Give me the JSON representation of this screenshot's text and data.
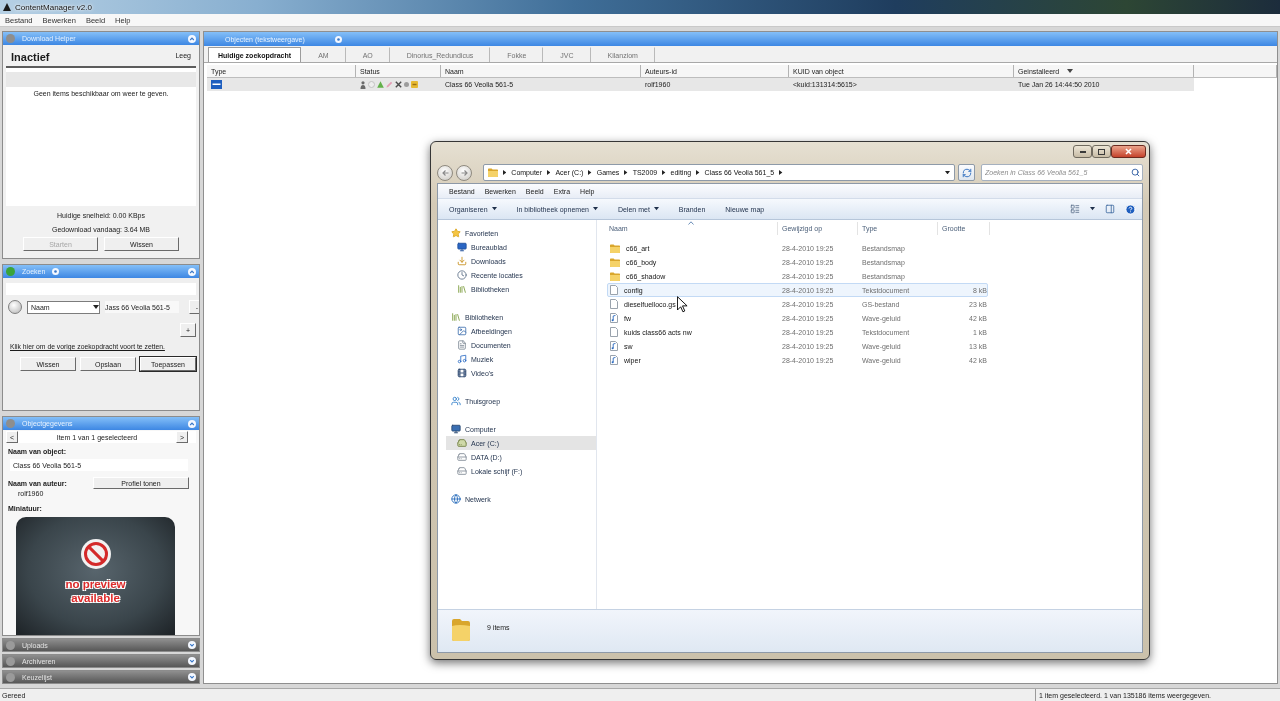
{
  "window": {
    "title": "ContentManager v2.0"
  },
  "menu": [
    "Bestand",
    "Bewerken",
    "Beeld",
    "Help"
  ],
  "left_panels": [
    {
      "kind": "download_helper",
      "title": "Download Helper",
      "expanded": true,
      "color": "#8e8e8e",
      "state": "Inactief",
      "queue": "Leeg",
      "empty_message": "Geen items beschikbaar om weer te geven.",
      "speed": "Huidige snelheid: 0.00 KBps",
      "downloaded_today": "Gedownload vandaag: 3.64 MB",
      "buttons": [
        {
          "label": "Starten",
          "disabled": true
        },
        {
          "label": "Wissen",
          "disabled": false
        }
      ]
    },
    {
      "kind": "search",
      "title": "Zoeken",
      "expanded": true,
      "color": "#3aa43a",
      "field": "Naam",
      "value": "Jass 66 Veolia 561-5",
      "remove_button": "-",
      "add_button": "+",
      "link": "Klik hier om de vorige zoekopdracht voort te zetten.",
      "buttons": [
        {
          "label": "Wissen",
          "default": false
        },
        {
          "label": "Opslaan",
          "default": false
        },
        {
          "label": "Toepassen",
          "default": true
        }
      ]
    },
    {
      "kind": "object_details",
      "title": "Objectgegevens",
      "expanded": true,
      "color": "#8e8e8e",
      "previous": "<",
      "next": ">",
      "selection": "Item 1 van 1 geselecteerd",
      "name_label": "Naam van object:",
      "name": "Class 66 Veolia 561-5",
      "author_label": "Naam van auteur:",
      "profile_button": "Profiel tonen",
      "author": "rolf1960",
      "thumbnail_label": "Miniatuur:",
      "thumbnail_text": "no preview available"
    },
    {
      "kind": "uploads",
      "title": "Uploads",
      "expanded": false,
      "color": "#9a9a9a"
    },
    {
      "kind": "archive",
      "title": "Archiveren",
      "expanded": false,
      "color": "#9a9a9a"
    },
    {
      "kind": "pick_list",
      "title": "Keuzelijst",
      "expanded": false,
      "color": "#9a9a9a"
    }
  ],
  "objects": {
    "title": "Objecten (tekstweergave)",
    "tabs": [
      {
        "label": "Huidige zoekopdracht",
        "selected": true
      },
      {
        "label": "AM",
        "selected": false
      },
      {
        "label": "AO",
        "selected": false
      },
      {
        "label": "Dinorius_Redundicus",
        "selected": false
      },
      {
        "label": "Fokke",
        "selected": false
      },
      {
        "label": "JVC",
        "selected": false
      },
      {
        "label": "Kilanziom",
        "selected": false
      }
    ],
    "columns": [
      {
        "label": "Type",
        "sorted": false
      },
      {
        "label": "Status",
        "sorted": false
      },
      {
        "label": "Naam",
        "sorted": false
      },
      {
        "label": "Auteurs-id",
        "sorted": false
      },
      {
        "label": "KUID van object",
        "sorted": false
      },
      {
        "label": "Geinstalleerd",
        "sorted": true
      }
    ],
    "rows": [
      {
        "name": "Class 66 Veolia 561-5",
        "author_id": "rolf1960",
        "kuid": "<kuid:131314:5615>",
        "installed": "Tue Jan 26 14:44:50 2010",
        "selected": true
      }
    ]
  },
  "explorer": {
    "breadcrumb": [
      "Computer",
      "Acer (C:)",
      "Games",
      "TS2009",
      "editing",
      "Class 66 Veolia 561_5"
    ],
    "search": {
      "placeholder": "Zoeken in Class 66 Veolia 561_5"
    },
    "menu": [
      "Bestand",
      "Bewerken",
      "Beeld",
      "Extra",
      "Help"
    ],
    "toolbar": [
      {
        "label": "Organiseren",
        "dropdown": true
      },
      {
        "label": "In bibliotheek opnemen",
        "dropdown": true
      },
      {
        "label": "Delen met",
        "dropdown": true
      },
      {
        "label": "Branden",
        "dropdown": false
      },
      {
        "label": "Nieuwe map",
        "dropdown": false
      }
    ],
    "navigation": [
      {
        "label": "Favorieten",
        "kind": "star",
        "selected": false,
        "children": [
          {
            "label": "Bureaublad",
            "kind": "desktop",
            "selected": false
          },
          {
            "label": "Downloads",
            "kind": "downloads",
            "selected": false
          },
          {
            "label": "Recente locaties",
            "kind": "recent",
            "selected": false
          },
          {
            "label": "Bibliotheken",
            "kind": "library",
            "selected": false
          }
        ]
      },
      {
        "label": "Bibliotheken",
        "kind": "library",
        "selected": false,
        "children": [
          {
            "label": "Afbeeldingen",
            "kind": "pictures",
            "selected": false
          },
          {
            "label": "Documenten",
            "kind": "documents",
            "selected": false
          },
          {
            "label": "Muziek",
            "kind": "music",
            "selected": false
          },
          {
            "label": "Video's",
            "kind": "videos",
            "selected": false
          }
        ]
      },
      {
        "label": "Thuisgroep",
        "kind": "homegroup",
        "selected": false
      },
      {
        "label": "Computer",
        "kind": "computer",
        "selected": false,
        "children": [
          {
            "label": "Acer (C:)",
            "kind": "system_drive",
            "selected": true
          },
          {
            "label": "DATA (D:)",
            "kind": "drive",
            "selected": false
          },
          {
            "label": "Lokale schijf (F:)",
            "kind": "drive",
            "selected": false
          }
        ]
      },
      {
        "label": "Netwerk",
        "kind": "network",
        "selected": false
      }
    ],
    "columns": [
      {
        "label": "Naam",
        "sorted": true
      },
      {
        "label": "Gewijzigd op",
        "sorted": false
      },
      {
        "label": "Type",
        "sorted": false
      },
      {
        "label": "Grootte",
        "sorted": false
      }
    ],
    "files": [
      {
        "name": "c66_art",
        "modified": "28-4-2010 19:25",
        "type": "Bestandsmap",
        "kind": "folder",
        "selected": false
      },
      {
        "name": "c66_body",
        "modified": "28-4-2010 19:25",
        "type": "Bestandsmap",
        "kind": "folder",
        "selected": false
      },
      {
        "name": "c66_shadow",
        "modified": "28-4-2010 19:25",
        "type": "Bestandsmap",
        "kind": "folder",
        "selected": false
      },
      {
        "name": "config",
        "modified": "28-4-2010 19:25",
        "type": "Tekstdocument",
        "size": "8 kB",
        "kind": "text",
        "selected": true
      },
      {
        "name": "dieselfuelloco.gs",
        "modified": "28-4-2010 19:25",
        "type": "GS-bestand",
        "size": "23 kB",
        "kind": "file",
        "selected": false
      },
      {
        "name": "fw",
        "modified": "28-4-2010 19:25",
        "type": "Wave-geluid",
        "size": "42 kB",
        "kind": "audio",
        "selected": false
      },
      {
        "name": "kuids class66 acts nw",
        "modified": "28-4-2010 19:25",
        "type": "Tekstdocument",
        "size": "1 kB",
        "kind": "text",
        "selected": false
      },
      {
        "name": "sw",
        "modified": "28-4-2010 19:25",
        "type": "Wave-geluid",
        "size": "13 kB",
        "kind": "audio",
        "selected": false
      },
      {
        "name": "wiper",
        "modified": "28-4-2010 19:25",
        "type": "Wave-geluid",
        "size": "42 kB",
        "kind": "audio",
        "selected": false
      }
    ],
    "item_count": "9 items"
  },
  "status_bar": {
    "left": "Gereed",
    "right": "1 item geselecteerd. 1 van 135186 items weergegeven."
  }
}
